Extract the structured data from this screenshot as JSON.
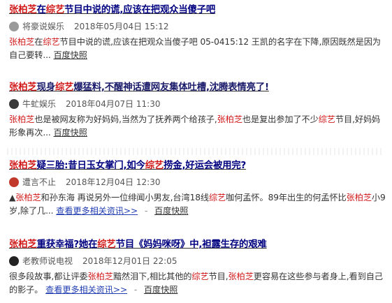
{
  "results": [
    {
      "title": [
        {
          "t": "张柏芝",
          "hl": true
        },
        {
          "t": "在",
          "hl": false
        },
        {
          "t": "综艺",
          "hl": true
        },
        {
          "t": "节目中说的谎,应该在把观众当傻子吧",
          "hl": false
        }
      ],
      "avatar_icon": "source-avatar-icon",
      "avatar_color": "#9a9a9a",
      "source": "将豪说娱乐",
      "date": "2018年05月04日 15:12",
      "snippet": [
        {
          "t": "张柏芝",
          "hl": true
        },
        {
          "t": "在",
          "hl": false
        },
        {
          "t": "综艺",
          "hl": true
        },
        {
          "t": "节目中说的谎,应该在把观众当傻子吧 05-0415:12 王凯的名字在下降,原因既然是因为自己要转...",
          "hl": false
        }
      ],
      "link": "百度快照"
    },
    {
      "title": [
        {
          "t": "张柏芝",
          "hl": true
        },
        {
          "t": "现身",
          "hl": false
        },
        {
          "t": "综艺",
          "hl": true
        },
        {
          "t": "爆猛料,不醒神话遭网友集体吐槽,沈腾表情亮了!",
          "hl": false
        }
      ],
      "avatar_icon": "source-avatar-icon",
      "avatar_color": "#3a3a3a",
      "source": "牛虻娱乐",
      "date": "2018年04月07日 11:30",
      "snippet": [
        {
          "t": "张柏芝",
          "hl": true
        },
        {
          "t": "也是被网友称为好妈妈,当然为了抚养两个给孩子,",
          "hl": false
        },
        {
          "t": "张柏芝",
          "hl": true
        },
        {
          "t": "也是复出参加了不少",
          "hl": false
        },
        {
          "t": "综艺",
          "hl": true
        },
        {
          "t": "节目,好妈妈形象再次...",
          "hl": false
        }
      ],
      "link": "百度快照"
    },
    {
      "title": [
        {
          "t": "张柏芝",
          "hl": true
        },
        {
          "t": "疑三胎:昔日玉女掌门,如今",
          "hl": false
        },
        {
          "t": "综艺",
          "hl": true
        },
        {
          "t": "捞金,好运会被用完?",
          "hl": false
        }
      ],
      "avatar_icon": "source-avatar-icon",
      "avatar_color": "#c0392b",
      "source": "遭言不止",
      "date": "2018年12月04日 12:30",
      "snippet": [
        {
          "t": "▲",
          "hl": false
        },
        {
          "t": "张柏芝",
          "hl": true
        },
        {
          "t": "和孙东海 再说另外一位绯闻小男友,台湾18线",
          "hl": false
        },
        {
          "t": "综艺",
          "hl": true
        },
        {
          "t": "咖何孟怀。89年出生的何孟怀比",
          "hl": false
        },
        {
          "t": "张柏芝",
          "hl": true
        },
        {
          "t": "小9岁,除了几...",
          "hl": false
        }
      ],
      "more": "查看更多相关资讯>>",
      "link": "百度快照"
    },
    {
      "title": [
        {
          "t": "张柏芝",
          "hl": true
        },
        {
          "t": "重获幸福?她在",
          "hl": false
        },
        {
          "t": "综艺",
          "hl": true
        },
        {
          "t": "节目《妈妈咪呀》中,袒露生存的艰难",
          "hl": false
        }
      ],
      "avatar_icon": "source-avatar-icon",
      "avatar_color": "#222222",
      "source": "老教师说电视",
      "date": "2018年12月01日 22:05",
      "snippet": [
        {
          "t": "很多段故事,都让评委",
          "hl": false
        },
        {
          "t": "张柏芝",
          "hl": true
        },
        {
          "t": "黯然泪下,相比其他的",
          "hl": false
        },
        {
          "t": "综艺",
          "hl": true
        },
        {
          "t": "节目,",
          "hl": false
        },
        {
          "t": "张柏芝",
          "hl": true
        },
        {
          "t": "更容易在这些参与者身上,看到自己的影子。",
          "hl": false
        }
      ],
      "more": "查看更多相关资讯>>",
      "link": "百度快照"
    }
  ],
  "separator_dot": "-"
}
